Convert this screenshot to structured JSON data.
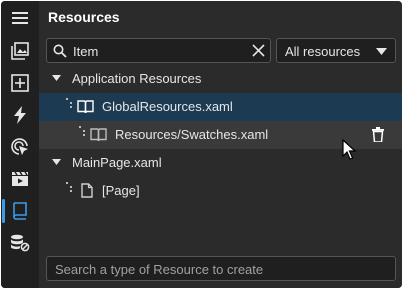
{
  "panel": {
    "title": "Resources"
  },
  "search": {
    "value": "Item"
  },
  "filter": {
    "selected": "All resources"
  },
  "tree": {
    "app_resources": "Application Resources",
    "global_resources": "GlobalResources.xaml",
    "swatches": "Resources/Swatches.xaml",
    "mainpage": "MainPage.xaml",
    "page": "[Page]"
  },
  "create": {
    "placeholder": "Search a type of Resource to create"
  },
  "rail": {
    "icons": [
      "menu-icon",
      "image-icon",
      "add-box-icon",
      "lightning-icon",
      "target-pointer-icon",
      "clapperboard-icon",
      "resource-book-icon",
      "database-link-icon"
    ],
    "active": "resource-book-icon"
  },
  "colors": {
    "accent": "#3d9be9",
    "selection": "#1c3a52",
    "hover": "#3a3a3a"
  }
}
